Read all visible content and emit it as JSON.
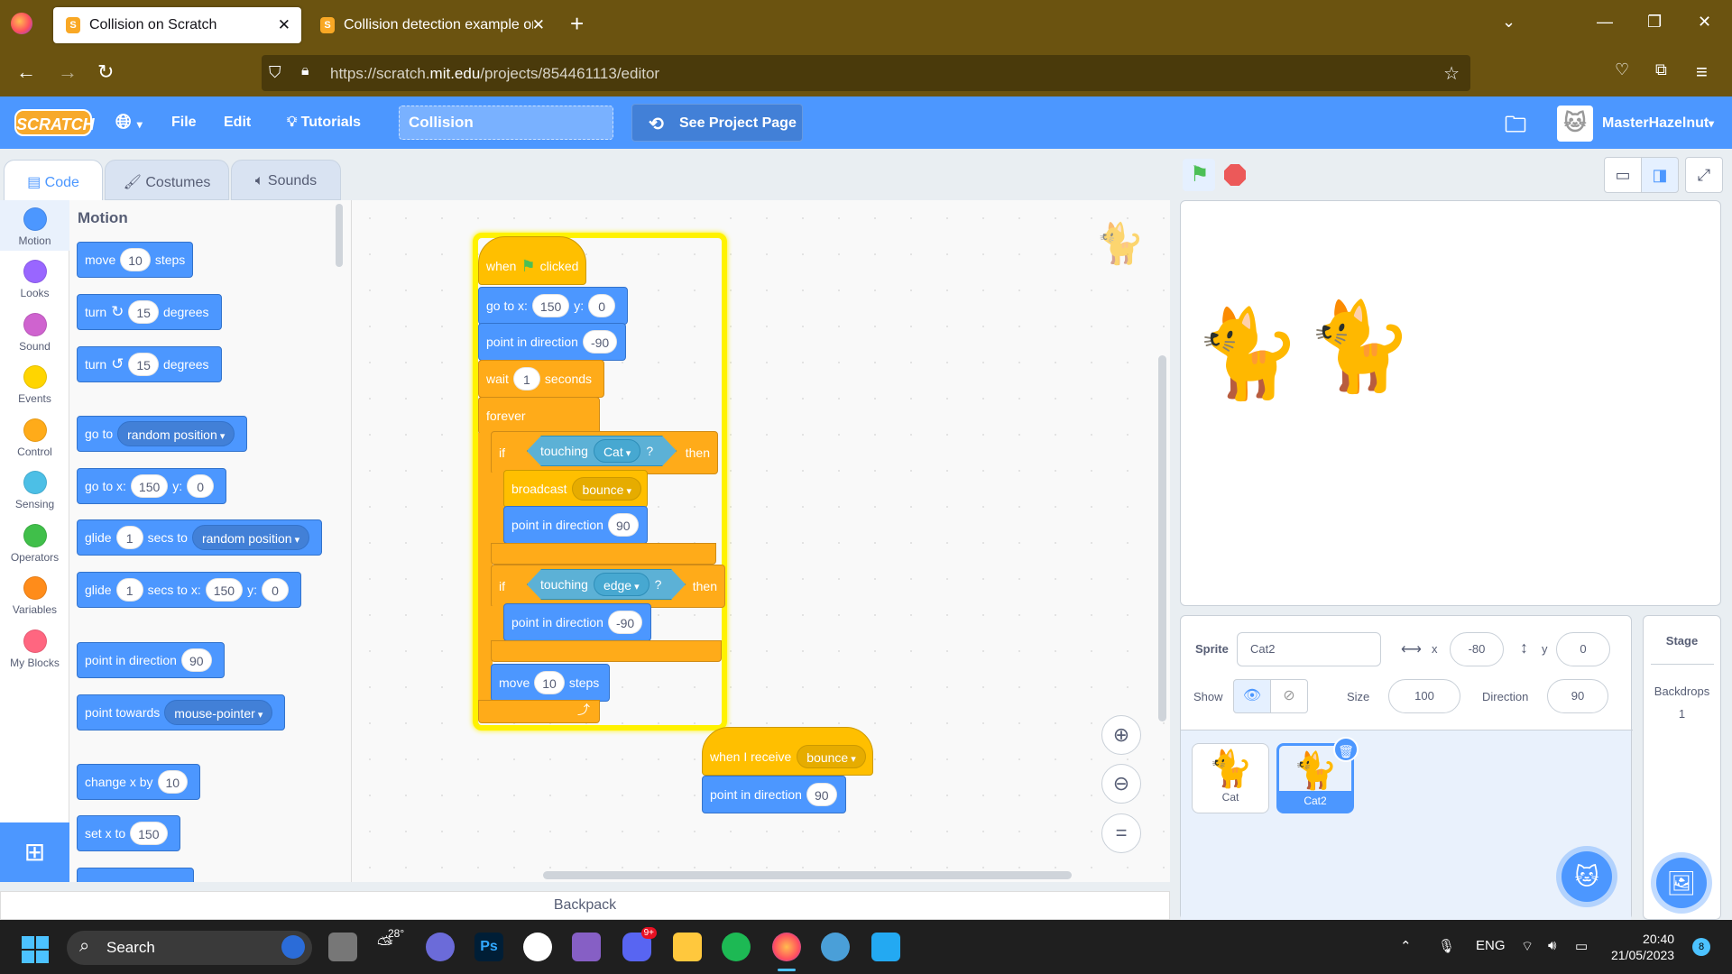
{
  "browser": {
    "tabs": [
      {
        "title": "Collision on Scratch",
        "active": true
      },
      {
        "title": "Collision detection example on",
        "active": false
      }
    ],
    "url_prefix": "https://scratch.",
    "url_domain": "mit.edu",
    "url_path": "/projects/854461113/editor"
  },
  "menubar": {
    "logo": "SCRATCH",
    "file": "File",
    "edit": "Edit",
    "tutorials": "Tutorials",
    "project_title": "Collision",
    "see_project": "See Project Page",
    "username": "MasterHazelnut"
  },
  "editor_tabs": {
    "code": "Code",
    "costumes": "Costumes",
    "sounds": "Sounds"
  },
  "categories": [
    {
      "label": "Motion",
      "color": "#4c97ff"
    },
    {
      "label": "Looks",
      "color": "#9966ff"
    },
    {
      "label": "Sound",
      "color": "#cf63cf"
    },
    {
      "label": "Events",
      "color": "#ffd500"
    },
    {
      "label": "Control",
      "color": "#ffab19"
    },
    {
      "label": "Sensing",
      "color": "#4cbfe6"
    },
    {
      "label": "Operators",
      "color": "#40bf4a"
    },
    {
      "label": "Variables",
      "color": "#ff8c1a"
    },
    {
      "label": "My Blocks",
      "color": "#ff6680"
    }
  ],
  "palette": {
    "title": "Motion",
    "move": {
      "a": "move",
      "v": "10",
      "b": "steps"
    },
    "turn_right": {
      "a": "turn",
      "icon": "↻",
      "v": "15",
      "b": "degrees"
    },
    "turn_left": {
      "a": "turn",
      "icon": "↺",
      "v": "15",
      "b": "degrees"
    },
    "goto": {
      "a": "go to",
      "d": "random position"
    },
    "gotoxy": {
      "a": "go to x:",
      "x": "150",
      "b": "y:",
      "y": "0"
    },
    "glide": {
      "a": "glide",
      "v": "1",
      "b": "secs to",
      "d": "random position"
    },
    "glidexy": {
      "a": "glide",
      "v": "1",
      "b": "secs to x:",
      "x": "150",
      "c": "y:",
      "y": "0"
    },
    "point": {
      "a": "point in direction",
      "v": "90"
    },
    "towards": {
      "a": "point towards",
      "d": "mouse-pointer"
    },
    "changex": {
      "a": "change x by",
      "v": "10"
    },
    "setx": {
      "a": "set x to",
      "v": "150"
    }
  },
  "script1": {
    "hat": {
      "a": "when",
      "b": "clicked"
    },
    "goto": {
      "a": "go to x:",
      "x": "150",
      "b": "y:",
      "y": "0"
    },
    "point": {
      "a": "point in direction",
      "v": "-90"
    },
    "wait": {
      "a": "wait",
      "v": "1",
      "b": "seconds"
    },
    "forever": "forever",
    "if1": {
      "a": "if",
      "t": "touching",
      "d": "Cat",
      "q": "?",
      "b": "then"
    },
    "broadcast": {
      "a": "broadcast",
      "d": "bounce"
    },
    "point2": {
      "a": "point in direction",
      "v": "90"
    },
    "if2": {
      "a": "if",
      "t": "touching",
      "d": "edge",
      "q": "?",
      "b": "then"
    },
    "point3": {
      "a": "point in direction",
      "v": "-90"
    },
    "move": {
      "a": "move",
      "v": "10",
      "b": "steps"
    }
  },
  "script2": {
    "hat": {
      "a": "when I receive",
      "d": "bounce"
    },
    "point": {
      "a": "point in direction",
      "v": "90"
    }
  },
  "backpack": "Backpack",
  "sprite_info": {
    "sprite_label": "Sprite",
    "sprite_name": "Cat2",
    "x_label": "x",
    "x": "-80",
    "y_label": "y",
    "y": "0",
    "show_label": "Show",
    "size_label": "Size",
    "size": "100",
    "direction_label": "Direction",
    "direction": "90"
  },
  "sprites": [
    {
      "name": "Cat",
      "selected": false
    },
    {
      "name": "Cat2",
      "selected": true
    }
  ],
  "stage_pane": {
    "title": "Stage",
    "backdrops_label": "Backdrops",
    "backdrops_count": "1"
  },
  "taskbar": {
    "search": "Search",
    "weather": "28°",
    "discord_badge": "9+",
    "lang": "ENG",
    "time": "20:40",
    "date": "21/05/2023",
    "notif": "8"
  }
}
